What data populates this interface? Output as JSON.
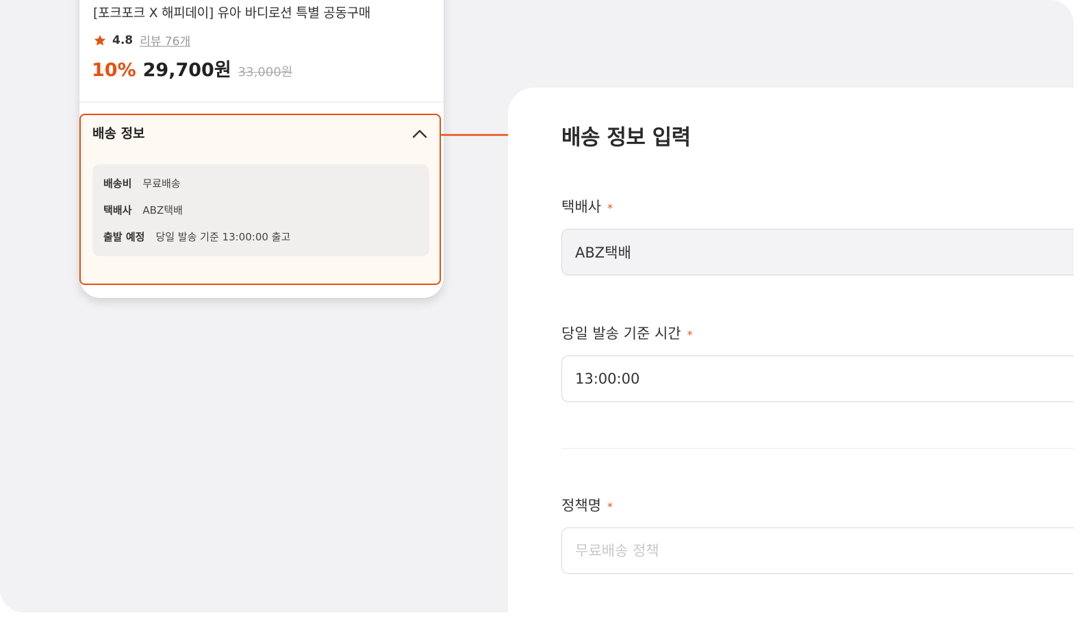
{
  "product": {
    "title": "[포크포크 X 해피데이] 유아 바디로션 특별 공동구매",
    "rating": "4.8",
    "review_link": "리뷰 76개",
    "discount": "10%",
    "price": "29,700원",
    "original_price": "33,000원"
  },
  "shipping_panel": {
    "title": "배송 정보",
    "rows": [
      {
        "label": "배송비",
        "value": "무료배송"
      },
      {
        "label": "택배사",
        "value": "ABZ택배"
      },
      {
        "label": "출발 예정",
        "value": "당일 발송 기준 13:00:00 출고"
      }
    ]
  },
  "form": {
    "title": "배송 정보 입력",
    "required_mark": "*",
    "courier": {
      "label": "택배사",
      "value": "ABZ택배"
    },
    "cutoff_time": {
      "label": "당일 발송 기준 시간",
      "value": "13:00:00"
    },
    "policy_name": {
      "label": "정책명",
      "placeholder": "무료배송 정책"
    }
  },
  "colors": {
    "accent": "#e8500e",
    "highlight_bg": "#fff9f4",
    "canvas_bg": "#f2f2f4"
  },
  "icons": {
    "rating": "star-icon",
    "collapse": "chevron-up-icon",
    "connector": "arrow-right-icon"
  }
}
